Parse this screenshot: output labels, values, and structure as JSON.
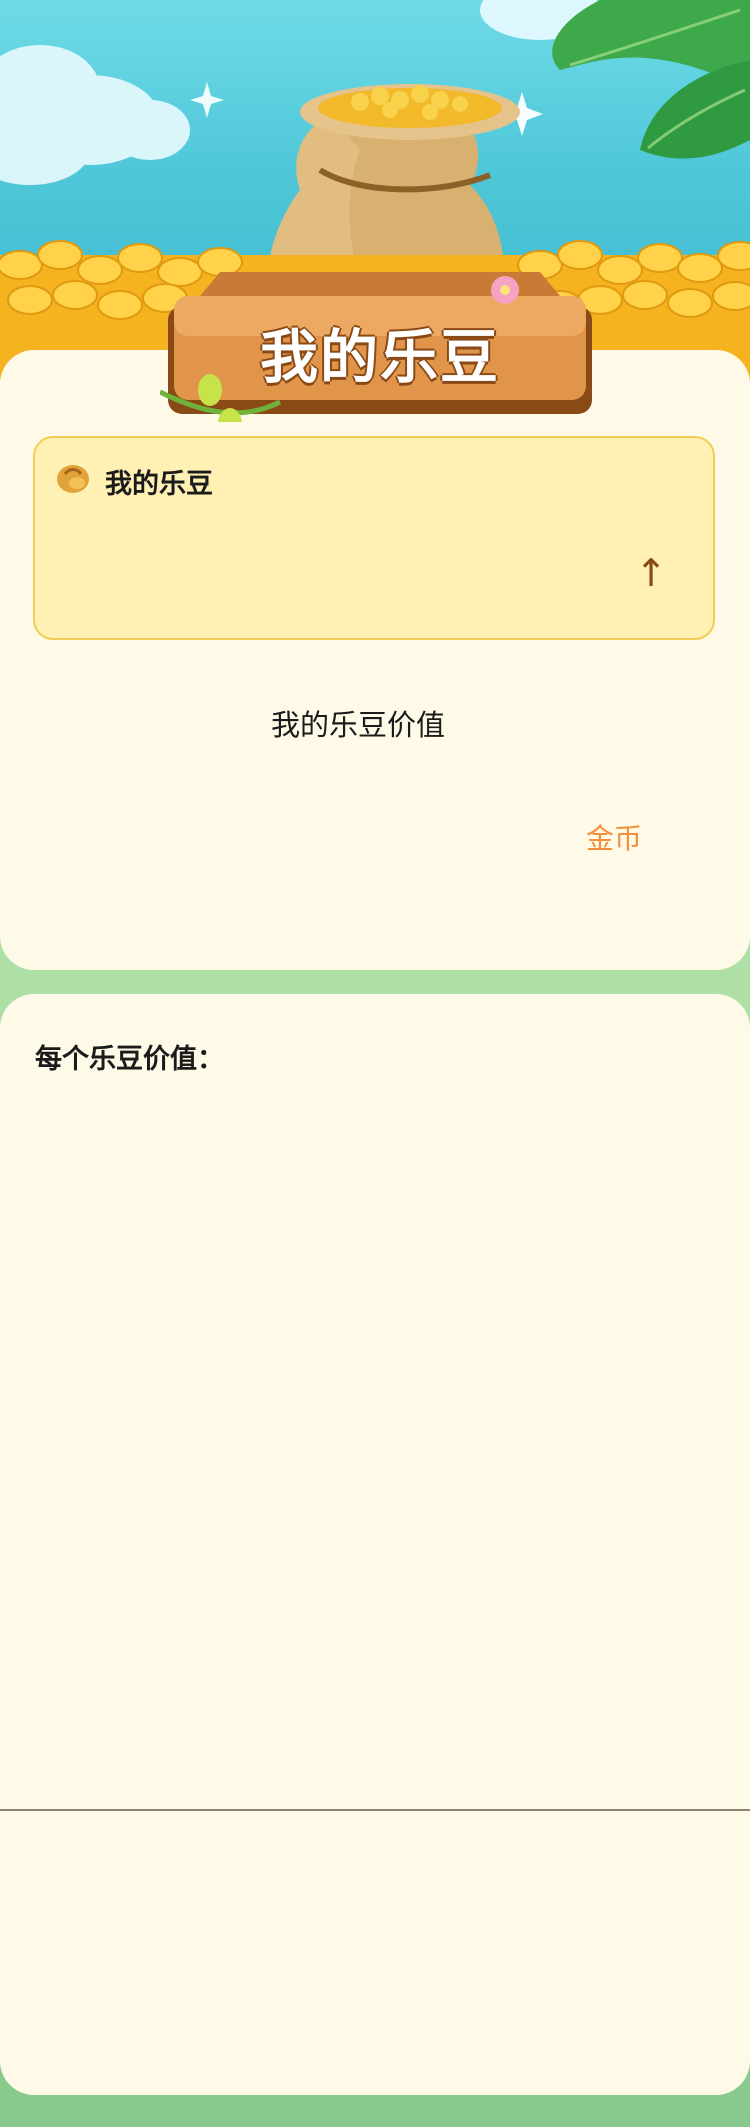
{
  "header": {
    "banner_title": "我的乐豆"
  },
  "beans_card": {
    "title": "我的乐豆",
    "icon": "bean-icon",
    "arrow": "↑"
  },
  "value_section": {
    "label": "我的乐豆价值",
    "gold_link": "金币"
  },
  "per_bean": {
    "label": "每个乐豆价值："
  },
  "colors": {
    "accent_orange": "#f39039",
    "card_bg": "#fffae8",
    "box_bg": "#fff0b3",
    "box_border": "#f0cd55",
    "wood": "#c97a34"
  }
}
